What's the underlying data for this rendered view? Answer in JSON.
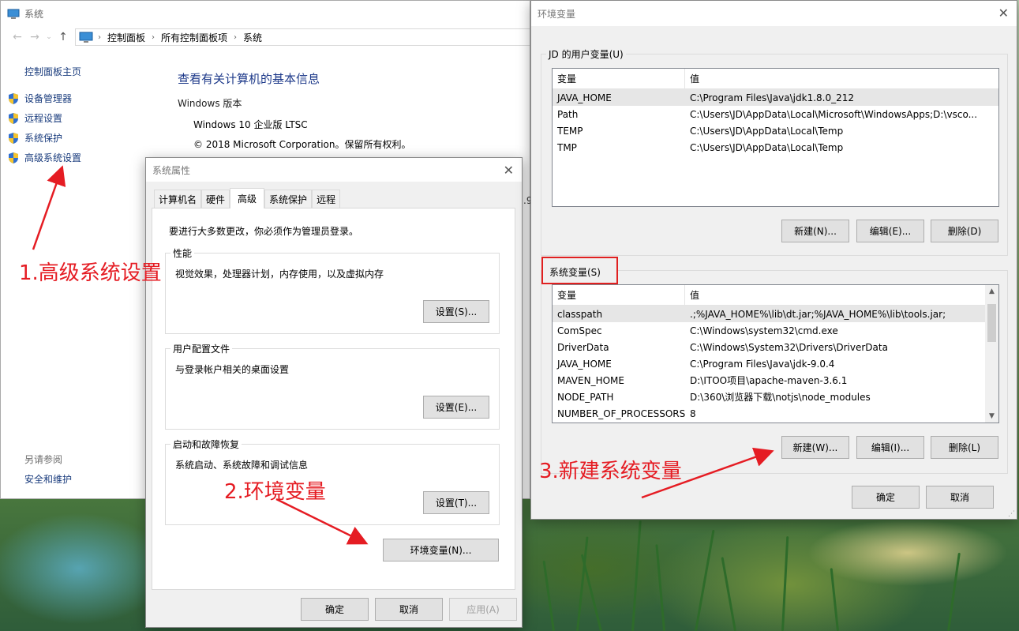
{
  "colors": {
    "annotation_red": "#e51c23",
    "link_blue": "#1a3c7d",
    "title_blue": "#1e3a8a"
  },
  "control_panel": {
    "window_title": "系统",
    "breadcrumb": [
      "控制面板",
      "所有控制面板项",
      "系统"
    ],
    "home_link": "控制面板主页",
    "left_links": [
      "设备管理器",
      "远程设置",
      "系统保护",
      "高级系统设置"
    ],
    "see_also_label": "另请参阅",
    "security_link": "安全和维护",
    "main_title": "查看有关计算机的基本信息",
    "windows_version_label": "Windows 版本",
    "windows_edition": "Windows 10 企业版 LTSC",
    "copyright": "© 2018 Microsoft Corporation。保留所有权利。",
    "cut_text": ".9"
  },
  "system_properties": {
    "title": "系统属性",
    "tabs": [
      "计算机名",
      "硬件",
      "高级",
      "系统保护",
      "远程"
    ],
    "admin_notice": "要进行大多数更改，你必须作为管理员登录。",
    "performance": {
      "label": "性能",
      "desc": "视觉效果，处理器计划，内存使用，以及虚拟内存",
      "button": "设置(S)..."
    },
    "user_profiles": {
      "label": "用户配置文件",
      "desc": "与登录帐户相关的桌面设置",
      "button": "设置(E)..."
    },
    "startup_recovery": {
      "label": "启动和故障恢复",
      "desc": "系统启动、系统故障和调试信息",
      "button": "设置(T)..."
    },
    "env_button": "环境变量(N)...",
    "ok": "确定",
    "cancel": "取消",
    "apply": "应用(A)"
  },
  "env_vars": {
    "title": "环境变量",
    "user_group_label": "JD 的用户变量(U)",
    "col_var": "变量",
    "col_val": "值",
    "user_vars": [
      {
        "name": "JAVA_HOME",
        "value": "C:\\Program Files\\Java\\jdk1.8.0_212"
      },
      {
        "name": "Path",
        "value": "C:\\Users\\JD\\AppData\\Local\\Microsoft\\WindowsApps;D:\\vsco..."
      },
      {
        "name": "TEMP",
        "value": "C:\\Users\\JD\\AppData\\Local\\Temp"
      },
      {
        "name": "TMP",
        "value": "C:\\Users\\JD\\AppData\\Local\\Temp"
      }
    ],
    "user_buttons": [
      "新建(N)...",
      "编辑(E)...",
      "删除(D)"
    ],
    "system_group_label": "系统变量(S)",
    "system_vars": [
      {
        "name": "classpath",
        "value": ".;%JAVA_HOME%\\lib\\dt.jar;%JAVA_HOME%\\lib\\tools.jar;"
      },
      {
        "name": "ComSpec",
        "value": "C:\\Windows\\system32\\cmd.exe"
      },
      {
        "name": "DriverData",
        "value": "C:\\Windows\\System32\\Drivers\\DriverData"
      },
      {
        "name": "JAVA_HOME",
        "value": "C:\\Program Files\\Java\\jdk-9.0.4"
      },
      {
        "name": "MAVEN_HOME",
        "value": "D:\\ITOO项目\\apache-maven-3.6.1"
      },
      {
        "name": "NODE_PATH",
        "value": "D:\\360\\浏览器下载\\notjs\\node_modules"
      },
      {
        "name": "NUMBER_OF_PROCESSORS",
        "value": "8"
      }
    ],
    "system_buttons": [
      "新建(W)...",
      "编辑(I)...",
      "删除(L)"
    ],
    "ok": "确定",
    "cancel": "取消"
  },
  "annotations": [
    "1.高级系统设置",
    "2.环境变量",
    "3.新建系统变量"
  ]
}
